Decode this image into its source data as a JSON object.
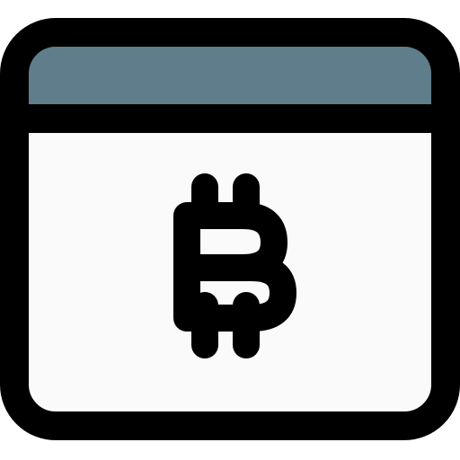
{
  "icon": {
    "name": "bitcoin-browser-window-icon",
    "colors": {
      "outline": "#000000",
      "title_bar": "#607d8b",
      "window_body": "#fafafa",
      "background": "#ffffff"
    }
  }
}
